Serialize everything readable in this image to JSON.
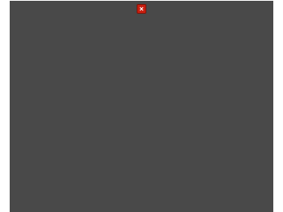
{
  "window": {
    "close_icon": "close-icon"
  },
  "colors": {
    "canvas_background": "#494949",
    "page_background": "#ffffff",
    "close_button": "#c81e0f"
  }
}
